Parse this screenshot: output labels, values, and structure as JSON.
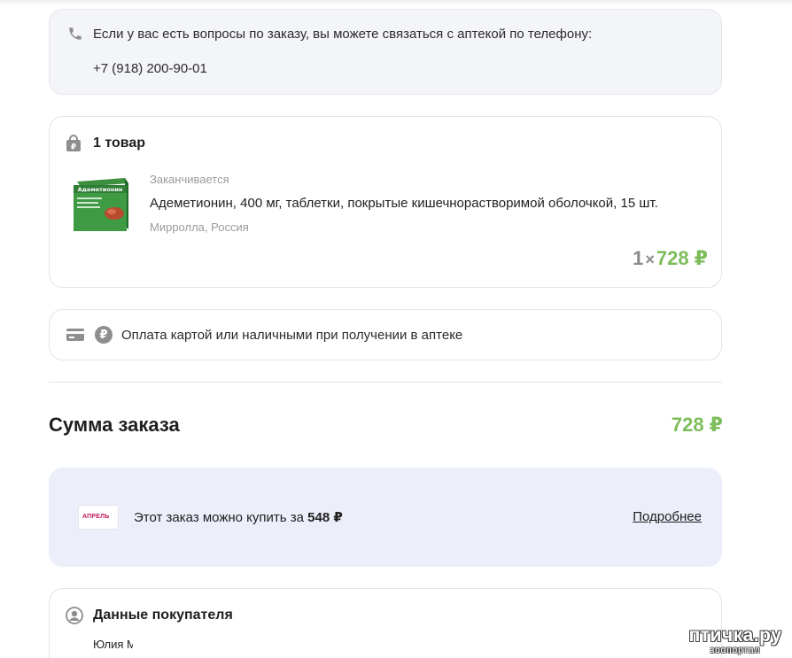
{
  "contact": {
    "message": "Если у вас есть вопросы по заказу, вы можете связаться с аптекой по телефону:",
    "phone": "+7 (918) 200-90-01",
    "icon": "phone-icon"
  },
  "items": {
    "count_label": "1 товар",
    "icon": "shopping-bag-icon",
    "product": {
      "stock_status": "Заканчивается",
      "name": "Адеметионин, 400 мг, таблетки, покрытые кишечнорастворимой оболочкой, 15 шт.",
      "manufacturer": "Мирролла, Россия",
      "quantity": "1",
      "times": "×",
      "price": "728 ₽",
      "box_label": "Адеметионин"
    }
  },
  "payment": {
    "text": "Оплата картой или наличными при получении в аптеке",
    "ruble_symbol": "₽",
    "icons": [
      "credit-card-icon",
      "ruble-icon"
    ]
  },
  "summary": {
    "label": "Сумма заказа",
    "total": "728 ₽"
  },
  "promo": {
    "logo_text": "АПРЕЛЬ",
    "text_before": "Этот заказ можно купить за ",
    "price": "548 ₽",
    "link": "Подробнее"
  },
  "buyer": {
    "title": "Данные покупателя",
    "name": "Юлия М",
    "icon": "user-icon"
  },
  "watermark": {
    "line1": "птичка.ру",
    "line2": "зоопортал"
  },
  "colors": {
    "price_green": "#7cbd5a",
    "promo_bg": "#eceef9",
    "card_border": "#e3e4e8"
  }
}
